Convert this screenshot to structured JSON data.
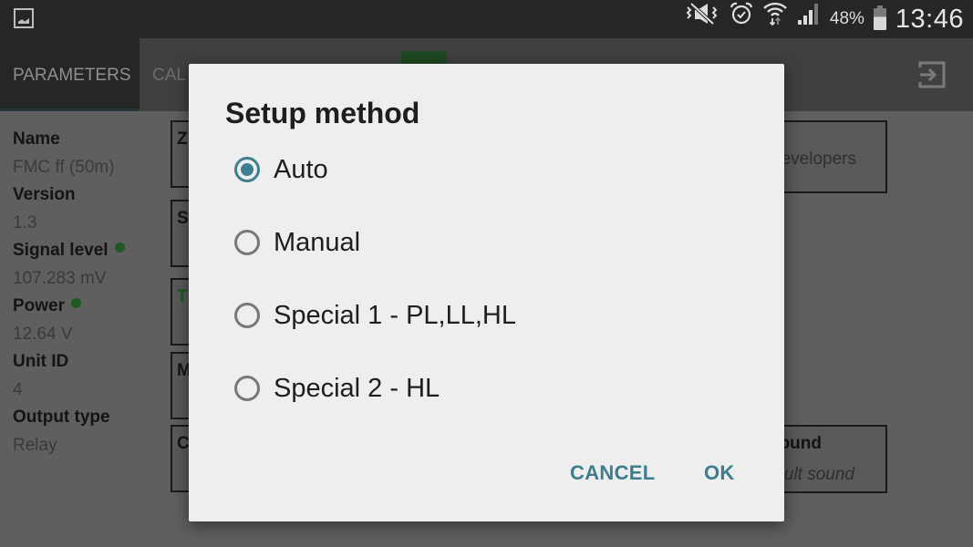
{
  "status_bar": {
    "left_icon": "image-icon",
    "icons": [
      "vibrate-mute-icon",
      "alarm-icon",
      "wifi-icon",
      "cell-signal-icon"
    ],
    "battery_percent": "48%",
    "battery_level": 0.48,
    "time": "13:46"
  },
  "app_bar": {
    "tabs": [
      {
        "label": "PARAMETERS",
        "selected": true
      },
      {
        "label": "CAL"
      }
    ],
    "exit_icon": "exit-icon"
  },
  "info_panel": [
    {
      "label": "Name",
      "value": "FMC ff (50m)",
      "status_dot": false
    },
    {
      "label": "Version",
      "value": "1.3",
      "status_dot": false
    },
    {
      "label": "Signal level",
      "value": "107.283 mV",
      "status_dot": true
    },
    {
      "label": "Power",
      "value": "12.64 V",
      "status_dot": true
    },
    {
      "label": "Unit ID",
      "value": "4",
      "status_dot": false
    },
    {
      "label": "Output type",
      "value": "Relay",
      "status_dot": false
    }
  ],
  "cards": [
    "Z",
    "S",
    "T",
    "M",
    "C"
  ],
  "right_cards": {
    "developers": "evelopers",
    "sound_title": "ound",
    "sound_value": "ult sound"
  },
  "colors": {
    "accent": "#3d8090",
    "status_green": "#1e5a22"
  },
  "dialog": {
    "title": "Setup method",
    "options": [
      {
        "label": "Auto",
        "checked": true
      },
      {
        "label": "Manual",
        "checked": false
      },
      {
        "label": "Special 1 - PL,LL,HL",
        "checked": false
      },
      {
        "label": "Special 2 - HL",
        "checked": false
      }
    ],
    "cancel_label": "CANCEL",
    "ok_label": "OK"
  }
}
